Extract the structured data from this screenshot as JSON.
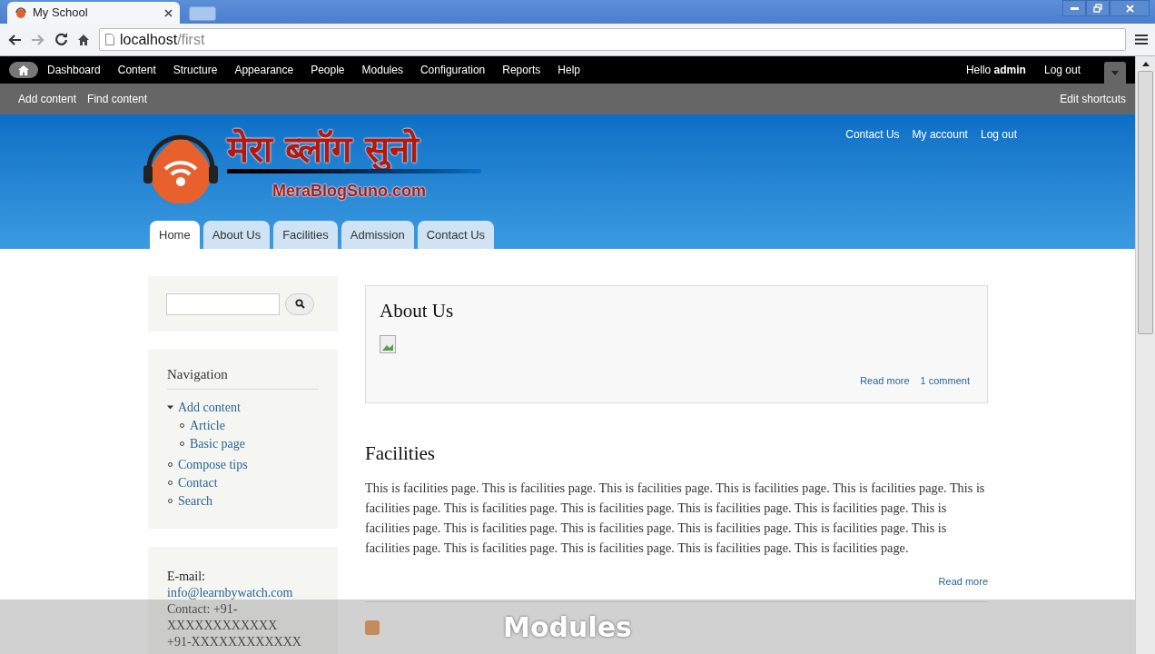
{
  "browser": {
    "tab_title": "My School",
    "url_host": "localhost",
    "url_path": "/first"
  },
  "admin_menu": {
    "items": [
      "Dashboard",
      "Content",
      "Structure",
      "Appearance",
      "People",
      "Modules",
      "Configuration",
      "Reports",
      "Help"
    ],
    "greeting": "Hello **admin**",
    "logout": "Log out"
  },
  "shortcuts": {
    "items": [
      "Add content",
      "Find content"
    ],
    "edit": "Edit shortcuts"
  },
  "header": {
    "secondary_links": [
      "Contact Us",
      "My account",
      "Log out"
    ],
    "logo_title": "मेरा ब्लॉग सुनो",
    "logo_subtitle": "MeraBlogSuno.com",
    "tabs": [
      {
        "label": "Home",
        "selected": true
      },
      {
        "label": "About Us",
        "selected": false
      },
      {
        "label": "Facilities",
        "selected": false
      },
      {
        "label": "Admission",
        "selected": false
      },
      {
        "label": "Contact Us",
        "selected": false
      }
    ]
  },
  "sidebar": {
    "navigation": {
      "title": "Navigation",
      "items": [
        {
          "label": "Add content",
          "expanded": true,
          "children": [
            {
              "label": "Article"
            },
            {
              "label": "Basic page"
            }
          ]
        },
        {
          "label": "Compose tips"
        },
        {
          "label": "Contact"
        },
        {
          "label": "Search"
        }
      ]
    },
    "contact": {
      "email_label": "E-mail:",
      "email": "info@learnbywatch.com",
      "lines": [
        "Contact: +91-",
        "XXXXXXXXXXXX",
        "+91-XXXXXXXXXXXX"
      ]
    }
  },
  "posts": [
    {
      "title": "About Us",
      "highlighted": true,
      "broken_image": true,
      "links": [
        "Read more",
        "1 comment"
      ]
    },
    {
      "title": "Facilities",
      "highlighted": false,
      "body": "This is facilities page. This is facilities page. This is facilities page. This is facilities page. This is facilities page. This is facilities page. This is facilities page. This is facilities page. This is facilities page. This is facilities page. This is facilities page. This is facilities page. This is facilities page. This is facilities page. This is facilities page. This is facilities page. This is facilities page. This is facilities page. This is facilities page. This is facilities page.",
      "links": [
        "Read more"
      ]
    }
  ],
  "caption": "Modules"
}
